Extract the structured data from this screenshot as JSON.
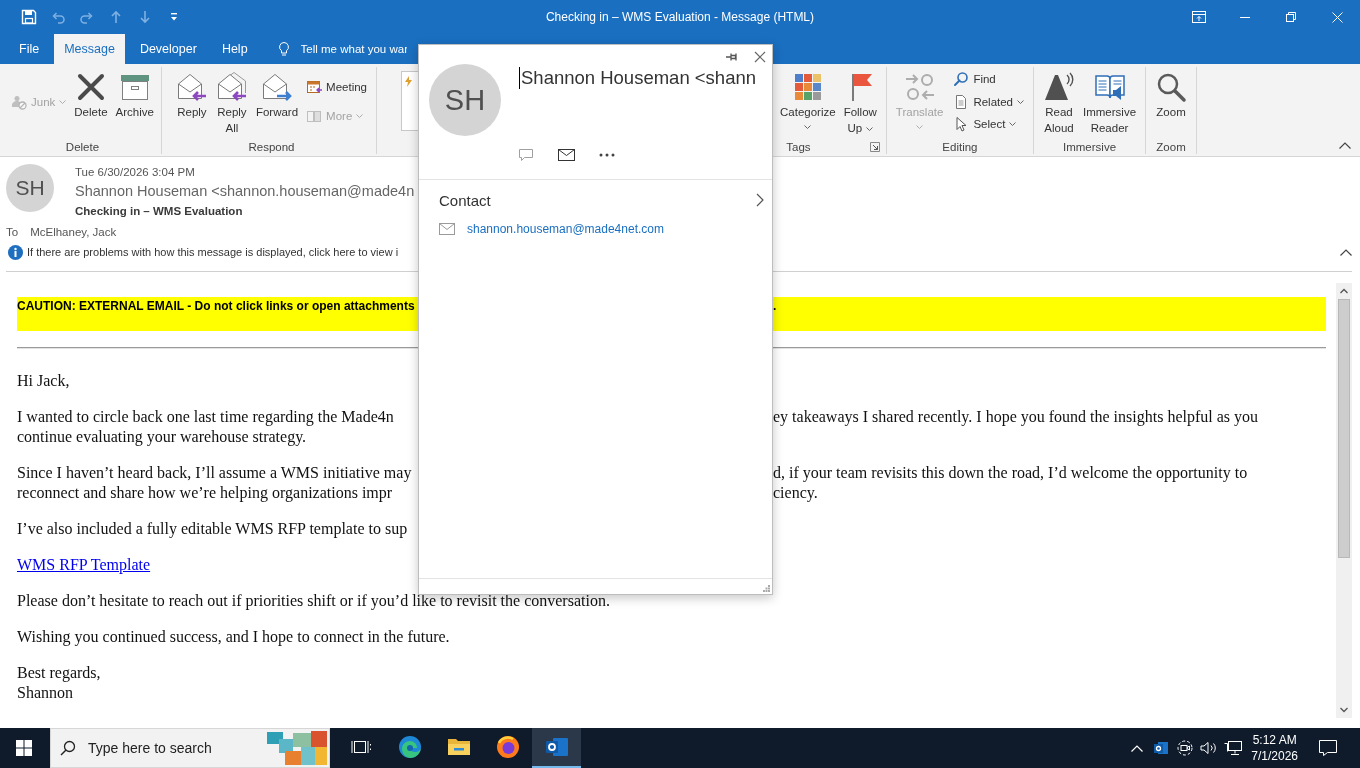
{
  "window": {
    "title": "Checking in – WMS Evaluation - Message (HTML)"
  },
  "quick_access": [
    {
      "kind": "save",
      "disabled": false
    },
    {
      "kind": "undo",
      "disabled": true
    },
    {
      "kind": "redo",
      "disabled": true
    },
    {
      "kind": "previous",
      "disabled": true
    },
    {
      "kind": "next",
      "disabled": true
    },
    {
      "kind": "customize",
      "disabled": false
    }
  ],
  "ribbon": {
    "tabs": [
      {
        "label": "File",
        "selected": false
      },
      {
        "label": "Message",
        "selected": true
      },
      {
        "label": "Developer",
        "selected": false
      },
      {
        "label": "Help",
        "selected": false
      }
    ],
    "tell_me": {
      "placeholder": "Tell me what you war"
    },
    "groups": [
      {
        "label": "Delete",
        "launcher": false,
        "commands": [
          {
            "label": "Junk",
            "kind": "small",
            "dropdown": true,
            "disabled": true
          },
          {
            "label": "Delete",
            "kind": "large",
            "dropdown": false,
            "disabled": false
          },
          {
            "label": "Archive",
            "kind": "large",
            "dropdown": false,
            "disabled": false
          }
        ]
      },
      {
        "label": "Respond",
        "launcher": false,
        "commands": [
          {
            "label": "Reply",
            "kind": "large",
            "dropdown": false,
            "disabled": false
          },
          {
            "label": "Reply All",
            "kind": "large",
            "dropdown": false,
            "disabled": false
          },
          {
            "label": "Forward",
            "kind": "large",
            "dropdown": false,
            "disabled": false
          },
          {
            "label": "Meeting",
            "kind": "small",
            "dropdown": false,
            "disabled": false
          },
          {
            "label": "More",
            "kind": "small",
            "dropdown": true,
            "disabled": true
          }
        ]
      },
      {
        "label": "Tags",
        "launcher": true,
        "commands": [
          {
            "label": "Categorize",
            "kind": "large",
            "dropdown": true,
            "disabled": false
          },
          {
            "label": "Follow Up",
            "kind": "large",
            "dropdown": true,
            "disabled": false
          }
        ]
      },
      {
        "label": "Editing",
        "launcher": false,
        "commands": [
          {
            "label": "Translate",
            "kind": "large",
            "dropdown": true,
            "disabled": true
          },
          {
            "label": "Find",
            "kind": "small",
            "dropdown": false,
            "disabled": false
          },
          {
            "label": "Related",
            "kind": "small",
            "dropdown": true,
            "disabled": false
          },
          {
            "label": "Select",
            "kind": "small",
            "dropdown": true,
            "disabled": false
          }
        ]
      },
      {
        "label": "Immersive",
        "launcher": false,
        "commands": [
          {
            "label": "Read Aloud",
            "kind": "large",
            "dropdown": false,
            "disabled": false
          },
          {
            "label": "Immersive Reader",
            "kind": "large",
            "dropdown": false,
            "disabled": false
          }
        ]
      },
      {
        "label": "Zoom",
        "launcher": false,
        "commands": [
          {
            "label": "Zoom",
            "kind": "large",
            "dropdown": false,
            "disabled": false
          }
        ]
      }
    ]
  },
  "message_header": {
    "initials": "SH",
    "date": "Tue 6/30/2026 3:04 PM",
    "sender": "Shannon Houseman <shannon.houseman@made4n",
    "subject": "Checking in – WMS Evaluation",
    "to_label": "To",
    "to": "McElhaney, Jack",
    "info_bar": "If there are problems with how this message is displayed, click here to view i"
  },
  "email_body": {
    "caution": {
      "text": "CAUTION: EXTERNAL EMAIL - Do not click links or open attachments",
      "tail": "."
    },
    "paragraphs": [
      {
        "kind": "text",
        "lines": [
          {
            "left": "Hi Jack,"
          }
        ]
      },
      {
        "kind": "text",
        "lines": [
          {
            "left": "I wanted to circle back one last time regarding the Made4n",
            "right": "ey takeaways I shared recently. I hope you found the insights helpful as you"
          },
          {
            "left": "continue evaluating your warehouse strategy."
          }
        ]
      },
      {
        "kind": "text",
        "lines": [
          {
            "left": "Since I haven’t heard back, I’ll assume a WMS initiative may",
            "right": "d, if your team revisits this down the road, I’d welcome the opportunity to"
          },
          {
            "left": "reconnect and share how we’re helping organizations impr",
            "right": "ciency."
          }
        ]
      },
      {
        "kind": "text",
        "lines": [
          {
            "left": "I’ve also included a fully editable WMS RFP template to sup"
          }
        ]
      },
      {
        "kind": "link",
        "lines": [
          {
            "left": "WMS RFP Template"
          }
        ]
      },
      {
        "kind": "text",
        "lines": [
          {
            "left": "Please don’t hesitate to reach out if priorities shift or if you’d like to revisit the conversation."
          }
        ]
      },
      {
        "kind": "text",
        "lines": [
          {
            "left": "Wishing you continued success, and I hope to connect in the future."
          }
        ]
      },
      {
        "kind": "text",
        "lines": [
          {
            "left": "Best regards,"
          },
          {
            "left": "Shannon"
          }
        ]
      }
    ]
  },
  "contact_card": {
    "initials": "SH",
    "name": "Shannon Houseman <shann",
    "section": "Contact",
    "email": "shannon.houseman@made4net.com"
  },
  "taskbar": {
    "search": {
      "placeholder": "Type here to search"
    },
    "apps": [
      {
        "selected": false
      },
      {
        "selected": false
      },
      {
        "selected": false
      },
      {
        "selected": false
      },
      {
        "selected": true
      }
    ],
    "clock": {
      "time": "5:12 AM",
      "date": "7/1/2026"
    }
  }
}
